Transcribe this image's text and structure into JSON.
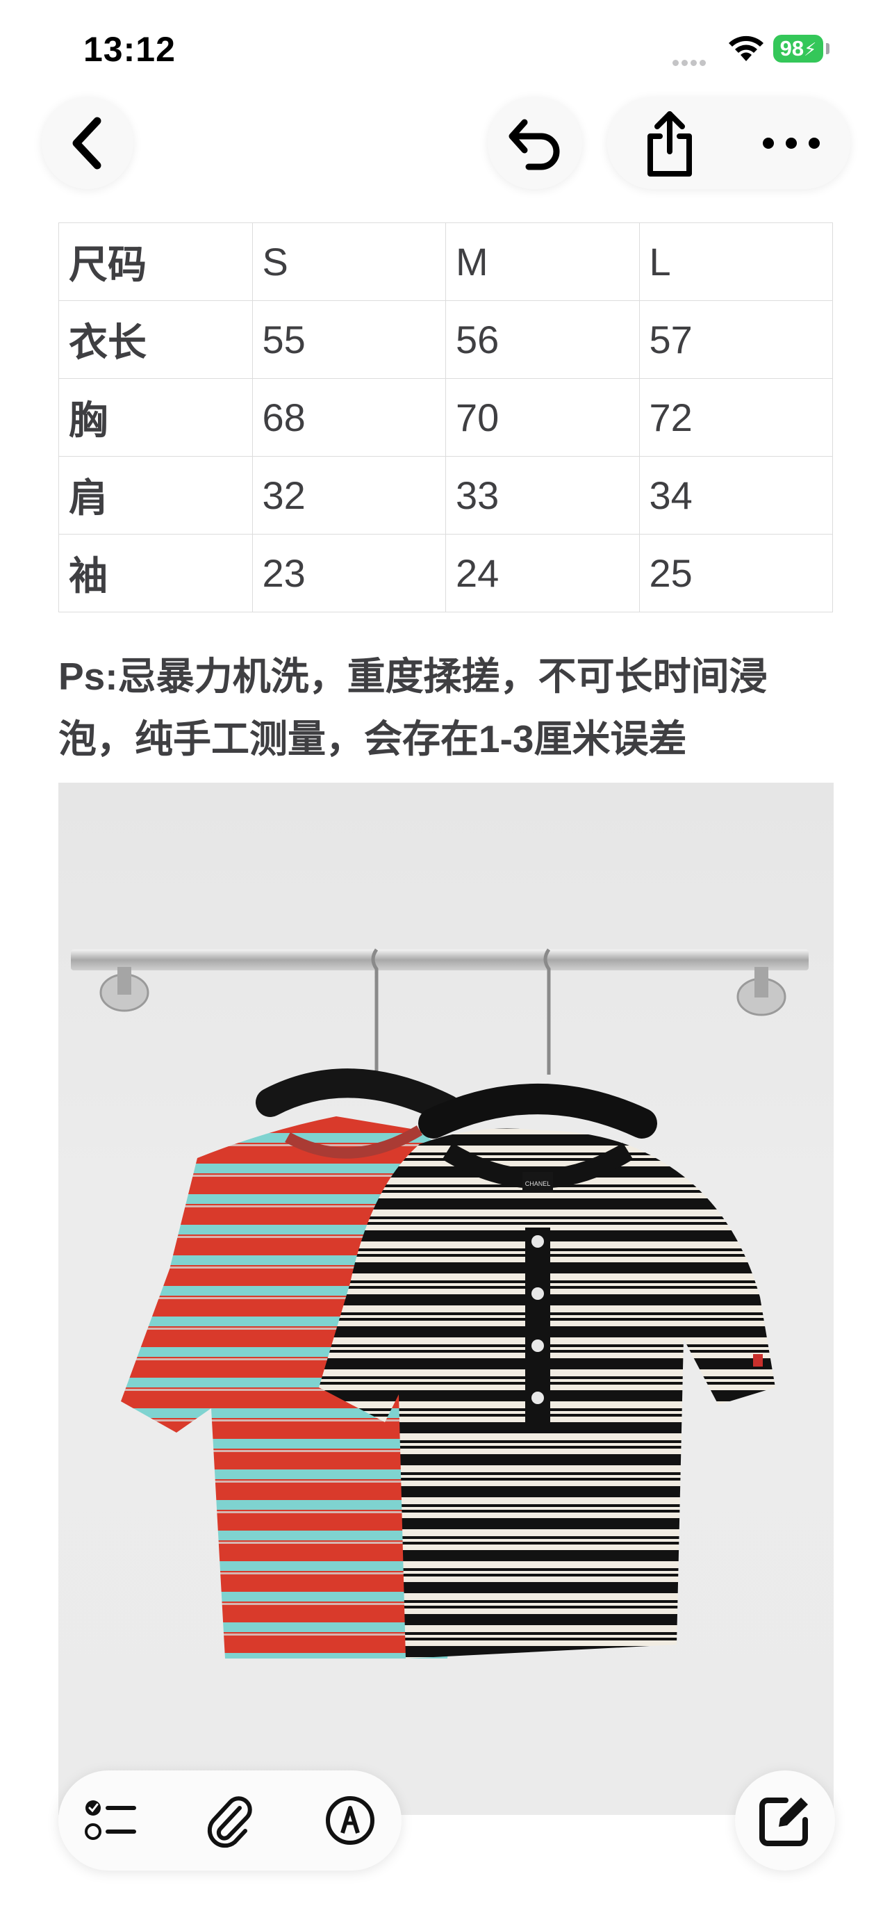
{
  "status": {
    "time": "13:12",
    "battery": "98"
  },
  "nav": {
    "back_icon": "chevron-left-icon",
    "undo_icon": "undo-arrow-icon",
    "share_icon": "share-icon",
    "more_icon": "ellipsis-icon"
  },
  "size_table": {
    "header": [
      "尺码",
      "S",
      "M",
      "L"
    ],
    "rows": [
      [
        "衣长",
        "55",
        "56",
        "57"
      ],
      [
        "胸",
        "68",
        "70",
        "72"
      ],
      [
        "肩",
        "32",
        "33",
        "34"
      ],
      [
        "袖",
        "23",
        "24",
        "25"
      ]
    ]
  },
  "note": {
    "line1": "Ps:忌暴力机洗，重度揉搓，不可长时间浸",
    "line2": "泡，纯手工测量，会存在1-3厘米误差"
  },
  "photo": {
    "description_icon": "clothing-photo",
    "tag_text": "CHANEL"
  },
  "toolbar": {
    "checklist_icon": "checklist-icon",
    "attachment_icon": "paperclip-icon",
    "markup_icon": "pen-markup-icon",
    "compose_icon": "compose-icon"
  }
}
